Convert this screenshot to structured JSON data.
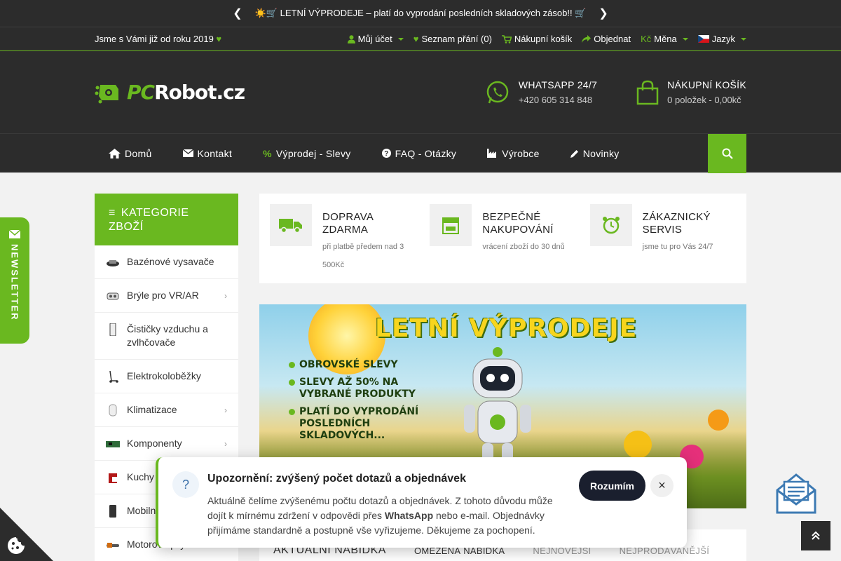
{
  "announcement": {
    "text": "☀️🛒 LETNÍ VÝPRODEJE – platí do vyprodání posledních skladových zásob!! 🛒",
    "prev": "❮",
    "next": "❯"
  },
  "userbar": {
    "since": "Jsme s Vámi již od roku 2019",
    "account": "Můj účet",
    "wishlist": "Seznam přání (0)",
    "cart": "Nákupní košík",
    "order": "Objednat",
    "currency_symbol": "Kč",
    "currency": "Měna",
    "language": "Jazyk"
  },
  "logo": {
    "pc": "PC",
    "rest": "Robot.cz"
  },
  "whatsapp": {
    "title": "WHATSAPP 24/7",
    "phone": "+420 605 314 848"
  },
  "header_cart": {
    "title": "NÁKUPNÍ KOŠÍK",
    "summary": "0 položek - 0,00kč"
  },
  "nav": [
    {
      "label": "Domů",
      "icon": "home-icon"
    },
    {
      "label": "Kontakt",
      "icon": "envelope-icon"
    },
    {
      "label": "Výprodej - Slevy",
      "icon": "percent-icon"
    },
    {
      "label": "FAQ - Otázky",
      "icon": "question-icon"
    },
    {
      "label": "Výrobce",
      "icon": "factory-icon"
    },
    {
      "label": "Novinky",
      "icon": "pencil-icon"
    }
  ],
  "categories_title": "KATEGORIE ZBOŽÍ",
  "categories": [
    {
      "label": "Bazénové vysavače",
      "sub": false
    },
    {
      "label": "Brýle pro VR/AR",
      "sub": true
    },
    {
      "label": "Čističky vzduchu a zvlhčovače",
      "sub": false
    },
    {
      "label": "Elektrokoloběžky",
      "sub": false
    },
    {
      "label": "Klimatizace",
      "sub": true
    },
    {
      "label": "Komponenty",
      "sub": true
    },
    {
      "label": "Kuchy",
      "sub": false
    },
    {
      "label": "Mobiln",
      "sub": false
    },
    {
      "label": "Motorové pily",
      "sub": false
    }
  ],
  "features": [
    {
      "title": "DOPRAVA ZDARMA",
      "sub": "při platbě předem nad 3 500Kč",
      "icon": "truck-icon"
    },
    {
      "title": "BEZPEČNÉ NAKUPOVÁNÍ",
      "sub": "vrácení zboží do 30 dnů",
      "icon": "shop-icon"
    },
    {
      "title": "ZÁKAZNICKÝ SERVIS",
      "sub": "jsme tu pro Vás 24/7",
      "icon": "alarm-clock-icon"
    }
  ],
  "banner": {
    "title": "LETNÍ VÝPRODEJE",
    "bullets": [
      "OBROVSKÉ SLEVY",
      "SLEVY AŽ 50% NA VYBRANÉ PRODUKTY",
      "PLATÍ DO VYPRODÁNÍ POSLEDNÍCH SKLADOVÝCH..."
    ]
  },
  "product_tabs": {
    "heading": "AKTUÁLNÍ NABÍDKA",
    "tabs": [
      "OMEZENÁ NABÍDKA",
      "NEJNOVĚJŠÍ",
      "NEJPRODÁVANĚJŠÍ"
    ]
  },
  "newsletter": "NEWSLETTER",
  "notice": {
    "icon_text": "?",
    "title": "Upozornění: zvýšený počet dotazů a objednávek",
    "body_1": "Aktuálně čelíme zvýšenému počtu dotazů a objednávek. Z tohoto důvodu může dojít k mírnému zdržení v odpovědi přes ",
    "body_bold": "WhatsApp",
    "body_2": " nebo e-mail. Objednávky přijímáme standardně a postupně vše vyřizujeme. Děkujeme za pochopení.",
    "button": "Rozumím",
    "close": "×"
  },
  "colors": {
    "accent": "#6ab820",
    "dark": "#2c2c2c",
    "button_dark": "#1a1f2e"
  }
}
